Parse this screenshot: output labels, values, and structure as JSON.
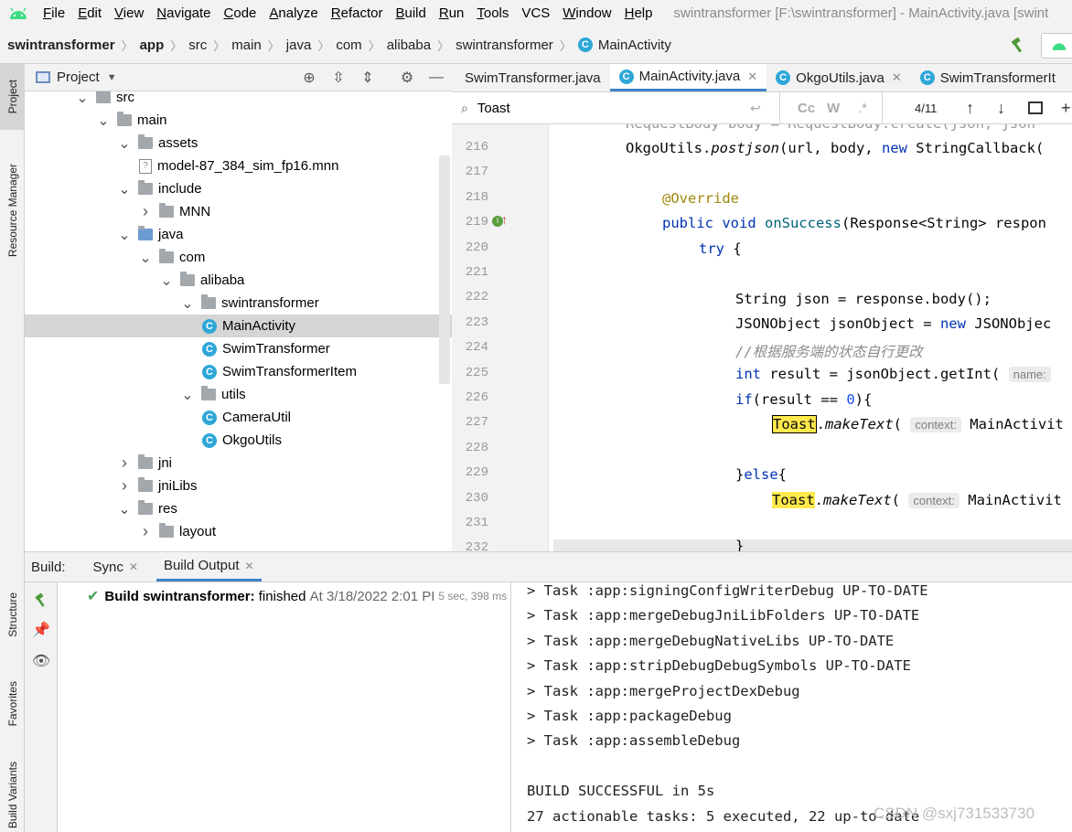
{
  "menubar": {
    "items": [
      "File",
      "Edit",
      "View",
      "Navigate",
      "Code",
      "Analyze",
      "Refactor",
      "Build",
      "Run",
      "Tools",
      "VCS",
      "Window",
      "Help"
    ],
    "window_title": "swintransformer [F:\\swintransformer] - MainActivity.java [swint"
  },
  "breadcrumb": {
    "items": [
      "swintransformer",
      "app",
      "src",
      "main",
      "java",
      "com",
      "alibaba",
      "swintransformer"
    ],
    "file": "MainActivity"
  },
  "left_strip": {
    "project": "Project",
    "resource_manager": "Resource Manager",
    "structure": "Structure",
    "favorites": "Favorites",
    "build_variants": "Build Variants"
  },
  "project_panel": {
    "title": "Project"
  },
  "tree": [
    {
      "label": "src",
      "depth": 0,
      "expanded": true,
      "kind": "folder"
    },
    {
      "label": "main",
      "depth": 1,
      "expanded": true,
      "kind": "folder"
    },
    {
      "label": "assets",
      "depth": 2,
      "expanded": true,
      "kind": "folder-res"
    },
    {
      "label": "model-87_384_sim_fp16.mnn",
      "depth": 3,
      "kind": "file-unknown"
    },
    {
      "label": "include",
      "depth": 2,
      "expanded": true,
      "kind": "folder"
    },
    {
      "label": "MNN",
      "depth": 3,
      "expanded": false,
      "kind": "folder"
    },
    {
      "label": "java",
      "depth": 2,
      "expanded": true,
      "kind": "folder-src"
    },
    {
      "label": "com",
      "depth": 3,
      "expanded": true,
      "kind": "folder-pkg"
    },
    {
      "label": "alibaba",
      "depth": 4,
      "expanded": true,
      "kind": "folder-pkg"
    },
    {
      "label": "swintransformer",
      "depth": 5,
      "expanded": true,
      "kind": "folder-pkg"
    },
    {
      "label": "MainActivity",
      "depth": 6,
      "kind": "class",
      "selected": true
    },
    {
      "label": "SwimTransformer",
      "depth": 6,
      "kind": "class"
    },
    {
      "label": "SwimTransformerItem",
      "depth": 6,
      "kind": "class"
    },
    {
      "label": "utils",
      "depth": 5,
      "expanded": true,
      "kind": "folder-pkg"
    },
    {
      "label": "CameraUtil",
      "depth": 6,
      "kind": "class"
    },
    {
      "label": "OkgoUtils",
      "depth": 6,
      "kind": "class"
    },
    {
      "label": "jni",
      "depth": 2,
      "expanded": false,
      "kind": "folder"
    },
    {
      "label": "jniLibs",
      "depth": 2,
      "expanded": false,
      "kind": "folder"
    },
    {
      "label": "res",
      "depth": 2,
      "expanded": true,
      "kind": "folder-res"
    },
    {
      "label": "layout",
      "depth": 3,
      "expanded": false,
      "kind": "folder"
    }
  ],
  "editor_tabs": [
    {
      "label": "SwimTransformer.java",
      "active": false,
      "closable": false
    },
    {
      "label": "MainActivity.java",
      "active": true,
      "closable": true
    },
    {
      "label": "OkgoUtils.java",
      "active": false,
      "closable": true
    },
    {
      "label": "SwimTransformerIt",
      "active": false,
      "closable": false
    }
  ],
  "find": {
    "query": "Toast",
    "match_case": "Cc",
    "words": "W",
    "regex": ".*",
    "count": "4/11"
  },
  "code": {
    "top_partial": "RequestBody body = RequestBody.create(json, json",
    "line_numbers": [
      "216",
      "217",
      "218",
      "219",
      "220",
      "221",
      "222",
      "223",
      "224",
      "225",
      "226",
      "227",
      "228",
      "229",
      "230",
      "231",
      "232"
    ],
    "l216": {
      "a": "OkgoUtils.",
      "b": "postjson",
      "c": "(url, body, ",
      "d": "new",
      "e": " StringCallback("
    },
    "l218": "@Override",
    "l219": {
      "a": "public void ",
      "b": "onSuccess",
      "c": "(Response<String> respon"
    },
    "l220": {
      "a": "try",
      "b": " {"
    },
    "l222": "String json = response.body();",
    "l223": {
      "a": "JSONObject jsonObject = ",
      "b": "new",
      "c": " JSONObjec"
    },
    "l224": "//根据服务端的状态自行更改",
    "l225": {
      "a": "int",
      "b": " result = jsonObject.getInt(",
      "hint": "name:"
    },
    "l226": {
      "a": "if",
      "b": "(result == ",
      "c": "0",
      "d": "){"
    },
    "l227": {
      "a": "Toast",
      ".b": ".",
      "b": "makeText",
      "c": "(",
      "hint": "context:",
      "d": "MainActivit"
    },
    "l229": {
      "a": "}",
      "b": "else",
      "c": "{"
    },
    "l230": {
      "a": "Toast",
      "b": "makeText",
      "c": "(",
      "hint": "context:",
      "d": "MainActivit"
    },
    "l232": "}"
  },
  "build": {
    "tabs": {
      "label": "Build:",
      "sync": "Sync",
      "output": "Build Output"
    },
    "result": {
      "title": "Build swintransformer:",
      "status": "finished",
      "time": "At 3/18/2022 2:01 PI",
      "duration": "5 sec, 398 ms"
    },
    "console": [
      "> Task :app:signingConfigWriterDebug UP-TO-DATE",
      "> Task :app:mergeDebugJniLibFolders UP-TO-DATE",
      "> Task :app:mergeDebugNativeLibs UP-TO-DATE",
      "> Task :app:stripDebugDebugSymbols UP-TO-DATE",
      "> Task :app:mergeProjectDexDebug",
      "> Task :app:packageDebug",
      "> Task :app:assembleDebug",
      "",
      "BUILD SUCCESSFUL in 5s",
      "27 actionable tasks: 5 executed, 22 up-to-date"
    ]
  },
  "watermark": "CSDN @sxj731533730",
  "colors": {
    "accent": "#4083c9",
    "android_green": "#3ddc84",
    "class_icon": "#2ea7d8",
    "find_highlight": "#ffe94d",
    "keyword": "#0033b3",
    "annotation": "#9e880d"
  }
}
